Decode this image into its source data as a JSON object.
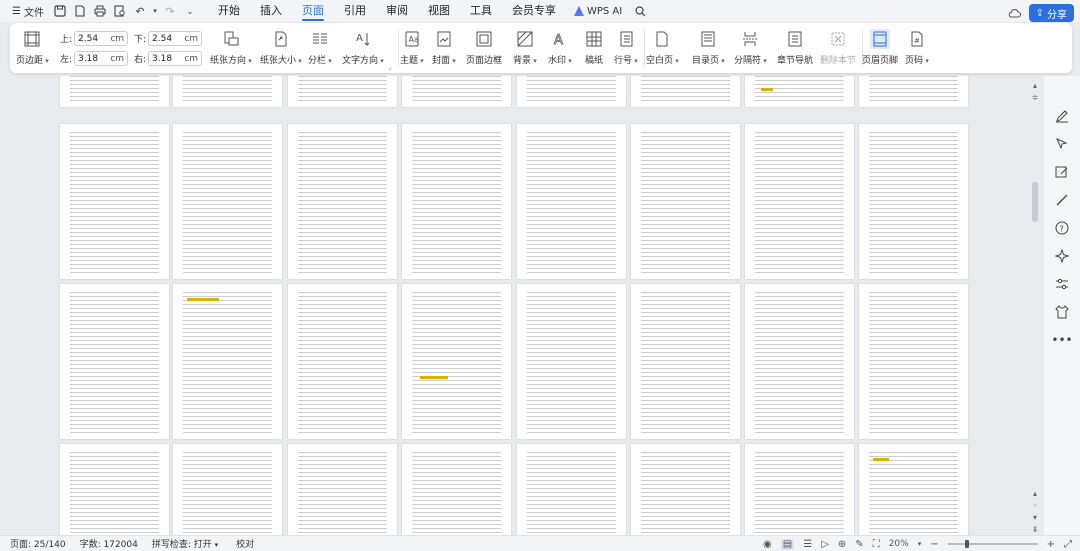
{
  "menubar": {
    "file_label": "文件",
    "tabs": [
      {
        "label": "开始",
        "active": false
      },
      {
        "label": "插入",
        "active": false
      },
      {
        "label": "页面",
        "active": true
      },
      {
        "label": "引用",
        "active": false
      },
      {
        "label": "审阅",
        "active": false
      },
      {
        "label": "视图",
        "active": false
      },
      {
        "label": "工具",
        "active": false
      },
      {
        "label": "会员专享",
        "active": false
      }
    ],
    "wps_ai_label": "WPS AI",
    "share_label": "分享",
    "accent_color": "#2b6fe0"
  },
  "ribbon": {
    "margins_label": "页边距",
    "margin_top_label": "上:",
    "margin_top_value": "2.54",
    "margin_bottom_label": "下:",
    "margin_bottom_value": "2.54",
    "margin_left_label": "左:",
    "margin_left_value": "3.18",
    "margin_right_label": "右:",
    "margin_right_value": "3.18",
    "unit": "cm",
    "orientation_label": "纸张方向",
    "size_label": "纸张大小",
    "columns_label": "分栏",
    "text_direction_label": "文字方向",
    "theme_label": "主题",
    "cover_label": "封面",
    "page_border_label": "页面边框",
    "background_label": "背景",
    "watermark_label": "水印",
    "manuscript_label": "稿纸",
    "line_number_label": "行号",
    "blank_page_label": "空白页",
    "toc_page_label": "目录页",
    "separator_label": "分隔符",
    "chapter_nav_label": "章节导航",
    "delete_section_label": "删除本节",
    "header_footer_label": "页眉页脚",
    "page_number_label": "页码"
  },
  "statusbar": {
    "page_label": "页面: 25/140",
    "word_count_label": "字数: 172004",
    "spell_check_label": "拼写检查: 打开",
    "proofread_label": "校对",
    "zoom_label": "20%",
    "zoom_level": 0.2
  }
}
